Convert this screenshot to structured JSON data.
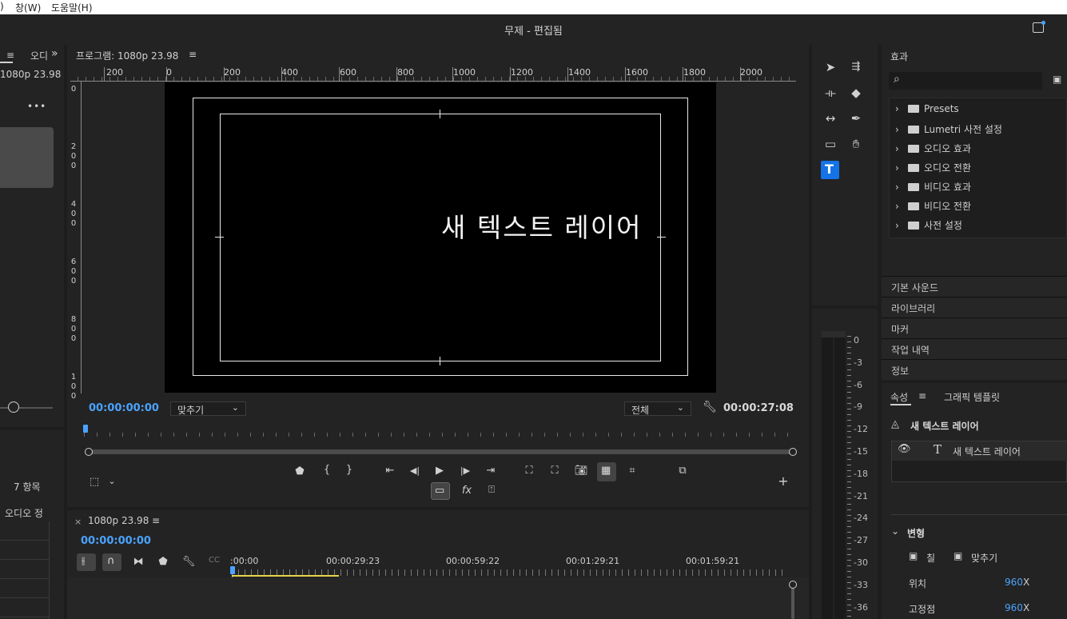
{
  "menubar": {
    "item0": ")",
    "item1": "창(W)",
    "item2": "도움말(H)"
  },
  "window": {
    "title": "무제 - 편집됨"
  },
  "left_panel": {
    "tab_menu": "≡",
    "tab_audio": "오디",
    "overflow": "»",
    "sequence_label": "1080p 23.98",
    "more": "•••",
    "item_count": "7 항목",
    "audio_col": "오디오 정"
  },
  "program_monitor": {
    "title": "프로그램: 1080p 23.98",
    "menu": "≡",
    "ruler_h": [
      "200",
      "0",
      "200",
      "400",
      "600",
      "800",
      "1000",
      "1200",
      "1400",
      "1600",
      "1800",
      "2000"
    ],
    "ruler_v": [
      "0",
      "2\n0\n0",
      "4\n0\n0",
      "6\n0\n0",
      "8\n0\n0",
      "1\n0\n0"
    ],
    "overlay_text": "새 텍스트 레이어",
    "timecode_current": "00:00:00:00",
    "zoom_select": "맞추기",
    "quality_select": "전체",
    "timecode_duration": "00:00:27:08",
    "fx_label": "fx"
  },
  "tools": {
    "selection": "selection-tool",
    "track_select": "track-select-tool",
    "ripple": "ripple-edit-tool",
    "razor": "razor-tool",
    "slip": "slip-tool",
    "pen": "pen-tool",
    "rectangle": "rectangle-tool",
    "hand": "hand-tool",
    "type": "T"
  },
  "effects_panel": {
    "title": "효과",
    "items": [
      "Presets",
      "Lumetri 사전 설정",
      "오디오 효과",
      "오디오 전환",
      "비디오 효과",
      "비디오 전환",
      "사전 설정"
    ]
  },
  "side_sections": [
    "기본 사운드",
    "라이브러리",
    "마커",
    "작업 내역",
    "정보"
  ],
  "properties_panel": {
    "tab_properties": "속성",
    "tab_menu": "≡",
    "tab_graphics": "그래픽 템플릿",
    "layer_header": "새 텍스트 레이어",
    "layer_item": "새 텍스트 레이어",
    "transform_label": "변형",
    "fill_label": "칠",
    "fit_label": "맞추기",
    "position_label": "위치",
    "position_value": "960",
    "position_unit": "X",
    "anchor_label": "고정점",
    "anchor_value": "960",
    "anchor_unit": "X"
  },
  "audio_meter": {
    "labels": [
      "0",
      "-3",
      "-6",
      "-9",
      "-12",
      "-15",
      "-18",
      "-21",
      "-24",
      "-27",
      "-30",
      "-33",
      "-36"
    ]
  },
  "timeline": {
    "close": "×",
    "sequence_name": "1080p 23.98",
    "menu": "≡",
    "timecode": "00:00:00:00",
    "ruler_labels": [
      ":00:00",
      "00:00:29:23",
      "00:00:59:22",
      "00:01:29:21",
      "00:01:59:21"
    ]
  },
  "colors": {
    "accent_blue": "#4aa3ff",
    "tool_active": "#1473e6",
    "playhead_yellow": "#e8d44d"
  }
}
